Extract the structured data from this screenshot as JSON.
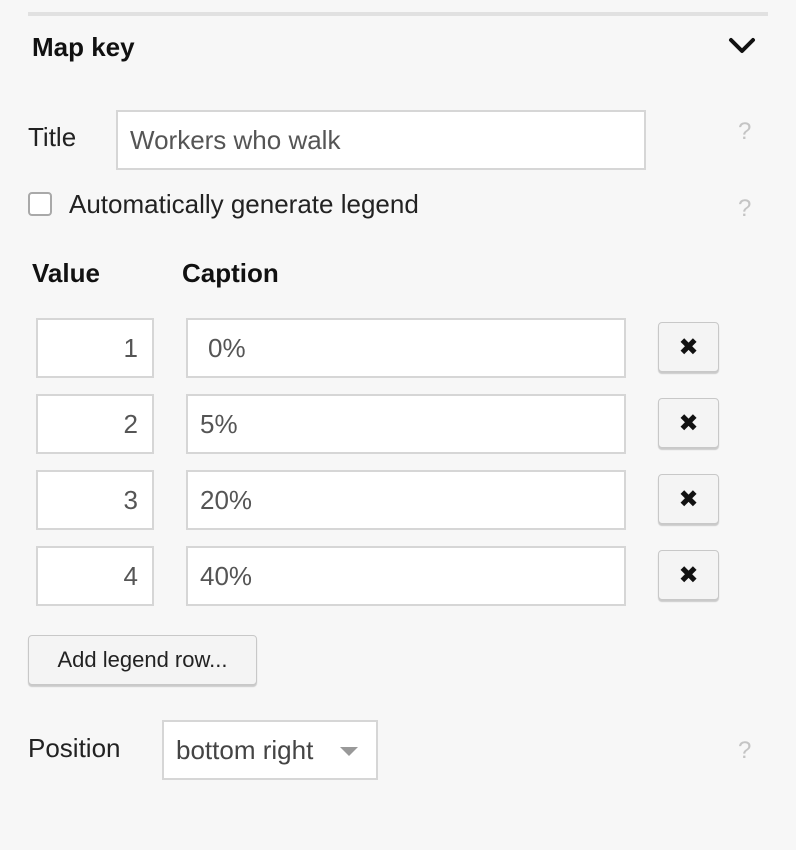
{
  "section": {
    "title": "Map key",
    "collapse_icon": "chevron-down-icon"
  },
  "title_field": {
    "label": "Title",
    "value": "Workers who walk",
    "help": "?"
  },
  "auto_legend": {
    "label": "Automatically generate legend",
    "checked": false,
    "help": "?"
  },
  "legend_table": {
    "value_header": "Value",
    "caption_header": "Caption",
    "rows": [
      {
        "value": "1",
        "caption": "0%"
      },
      {
        "value": "2",
        "caption": "5%"
      },
      {
        "value": "3",
        "caption": "20%"
      },
      {
        "value": "4",
        "caption": "40%"
      }
    ],
    "remove_icon": "✖"
  },
  "add_row_button": {
    "label": "Add legend row..."
  },
  "position_field": {
    "label": "Position",
    "selected": "bottom right",
    "help": "?"
  }
}
